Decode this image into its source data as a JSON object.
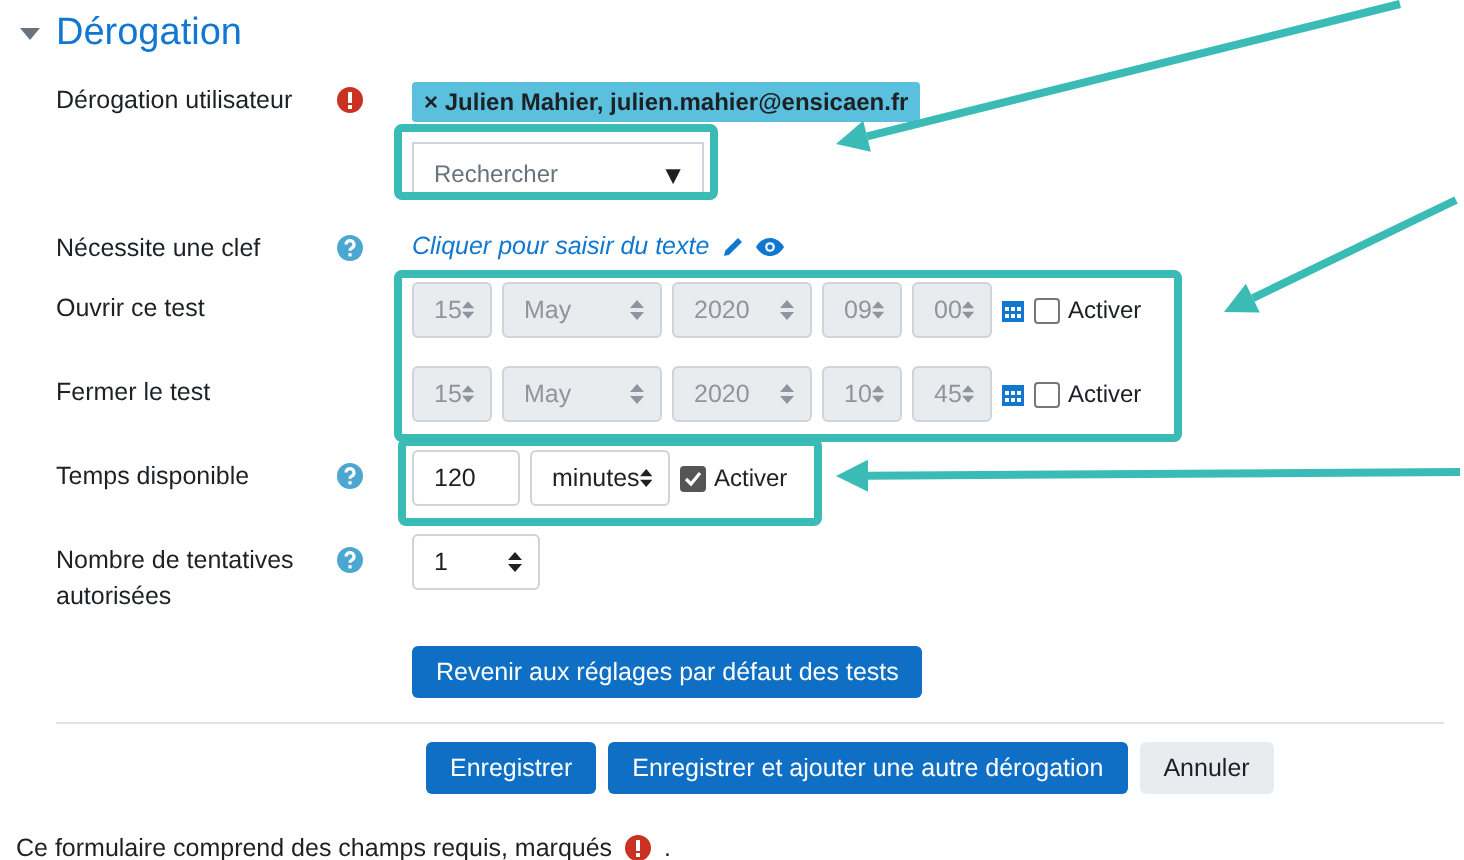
{
  "section": {
    "title": "Dérogation",
    "expanded": true
  },
  "fields": [
    {
      "kind": "autocomplete",
      "label": "Dérogation utilisateur",
      "required": true,
      "chip_remove": "×",
      "chip": "Julien Mahier, julien.mahier@ensicaen.fr",
      "placeholder": "Rechercher",
      "arrow": "▼"
    },
    {
      "kind": "editable",
      "label": "Nécessite une clef",
      "help": true,
      "text": "Cliquer pour saisir du texte"
    },
    {
      "kind": "datetime",
      "label": "Ouvrir ce test",
      "day": "15",
      "month": "May",
      "year": "2020",
      "hour": "09",
      "minute": "00",
      "checkbox": {
        "label": "Activer",
        "checked": false
      }
    },
    {
      "kind": "datetime",
      "label": "Fermer le test",
      "day": "15",
      "month": "May",
      "year": "2020",
      "hour": "10",
      "minute": "45",
      "checkbox": {
        "label": "Activer",
        "checked": false
      }
    },
    {
      "kind": "duration",
      "label": "Temps disponible",
      "help": true,
      "value": "120",
      "unit": "minutes",
      "checkbox": {
        "label": "Activer",
        "checked": true
      }
    },
    {
      "kind": "select",
      "label": "Nombre de tentatives autorisées",
      "help": true,
      "value": "1"
    }
  ],
  "reset_button": "Revenir aux réglages par défaut des tests",
  "buttons": [
    {
      "label": "Enregistrer",
      "kind": "primary"
    },
    {
      "label": "Enregistrer et ajouter une autre dérogation",
      "kind": "primary"
    },
    {
      "label": "Annuler",
      "kind": "secondary"
    }
  ],
  "footer": {
    "text": "Ce formulaire comprend des champs requis, marqués",
    "end": "."
  }
}
